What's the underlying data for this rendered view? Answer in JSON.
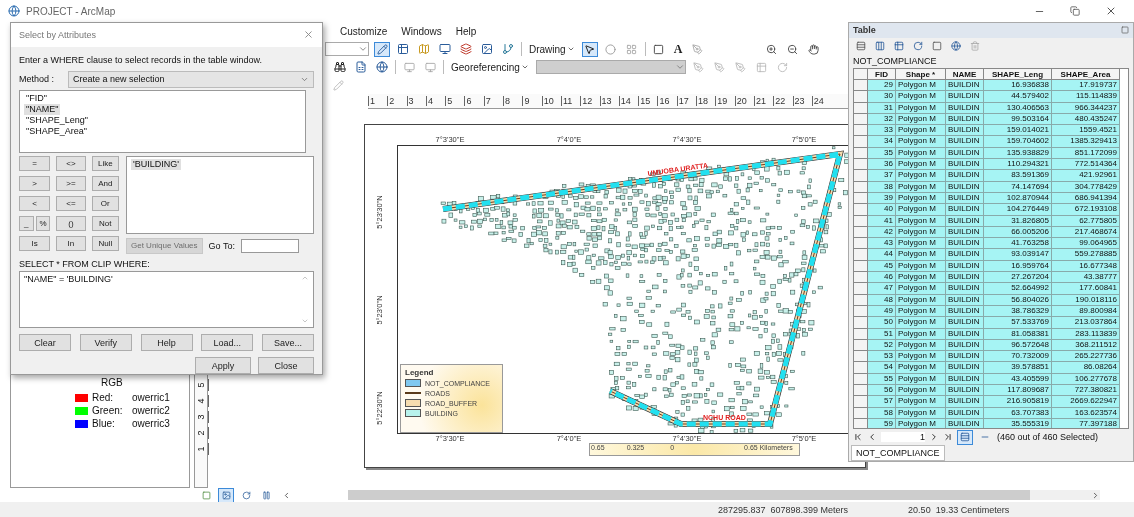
{
  "window": {
    "title": "PROJECT - ArcMap"
  },
  "menu": [
    "Customize",
    "Windows",
    "Help"
  ],
  "toolbars": {
    "drawing": "Drawing",
    "text_tool": "A",
    "georeferencing": "Georeferencing"
  },
  "ruler": {
    "horizontal": [
      "1",
      "2",
      "3",
      "4",
      "5",
      "6",
      "7",
      "8",
      "9",
      "10",
      "11",
      "12",
      "13",
      "14",
      "15",
      "16",
      "17",
      "18",
      "19",
      "20",
      "21",
      "22",
      "23",
      "24"
    ],
    "vertical": [
      "1",
      "2",
      "3",
      "4",
      "5"
    ]
  },
  "toc": {
    "band_title": "RGB",
    "bands": [
      {
        "label": "Red:",
        "value": "owerric1",
        "color": "#ff0000"
      },
      {
        "label": "Green:",
        "value": "owerric2",
        "color": "#00ff00"
      },
      {
        "label": "Blue:",
        "value": "owerric3",
        "color": "#0000ff"
      }
    ]
  },
  "map": {
    "top_labels": [
      "7°3'30\"E",
      "7°4'0\"E",
      "7°4'30\"E",
      "7°5'0\"E"
    ],
    "bottom_labels": [
      "7°3'30\"E",
      "7°4'0\"E",
      "7°4'30\"E",
      "7°5'0\"E"
    ],
    "left_labels": [
      "5°23'30\"N",
      "5°23'0\"N",
      "5°22'30\"N"
    ],
    "road_labels": [
      "UMUOBA URATTA",
      "NCHU ROAD"
    ],
    "legend": {
      "title": "Legend",
      "items": [
        {
          "label": "NOT_COMPLIANCE",
          "kind": "fill",
          "color": "#80c8f0"
        },
        {
          "label": "ROADS",
          "kind": "line",
          "color": "#5a3a1a"
        },
        {
          "label": "ROAD_BUFFER",
          "kind": "fill",
          "color": "#f5dcb0"
        },
        {
          "label": "BUILDING",
          "kind": "fill",
          "color": "#b8f2ec"
        }
      ]
    },
    "scale_bar": [
      "0.65",
      "0.325",
      "0",
      "0.65 Kilometers"
    ]
  },
  "status_bar": {
    "coordinates": "287295.837  607898.399 Meters",
    "page_position": "20.50  19.33 Centimeters"
  },
  "dialog": {
    "title": "Select by Attributes",
    "instruction": "Enter a WHERE clause to select records in the table window.",
    "method_label": "Method :",
    "method": "Create a new selection",
    "fields": [
      {
        "label": "\"FID\"",
        "selected": false
      },
      {
        "label": "\"NAME\"",
        "selected": true
      },
      {
        "label": "\"SHAPE_Leng\"",
        "selected": false
      },
      {
        "label": "\"SHAPE_Area\"",
        "selected": false
      }
    ],
    "operators": [
      [
        [
          "="
        ],
        [
          "<>"
        ],
        [
          "Like"
        ]
      ],
      [
        [
          ">"
        ],
        [
          ">="
        ],
        [
          "And"
        ]
      ],
      [
        [
          "<"
        ],
        [
          "<="
        ],
        [
          "Or"
        ]
      ],
      [
        [
          "_",
          "%"
        ],
        [
          "()"
        ],
        [
          "Not"
        ]
      ],
      [
        [
          "Is"
        ],
        [
          "In"
        ],
        [
          "Null"
        ]
      ]
    ],
    "values": [
      {
        "label": "'BUILDING'",
        "selected": true
      }
    ],
    "unique_values_button": {
      "label": "Get Unique Values",
      "disabled": true
    },
    "goto_label": "Go To:",
    "query_label": "SELECT * FROM CLIP WHERE:",
    "expression": "\"NAME\" = 'BUILDING'",
    "buttons": [
      "Clear",
      "Verify",
      "Help",
      "Load...",
      "Save..."
    ],
    "footer_buttons": [
      "Apply",
      "Close"
    ]
  },
  "table": {
    "title": "Table",
    "layer": "NOT_COMPLIANCE",
    "columns": [
      "FID",
      "Shape *",
      "NAME",
      "SHAPE_Leng",
      "SHAPE_Area"
    ],
    "rows": [
      {
        "cells": [
          "29",
          "Polygon M",
          "BUILDIN",
          "16.936838",
          "17.919737"
        ],
        "selected": true
      },
      {
        "cells": [
          "30",
          "Polygon M",
          "BUILDIN",
          "44.579402",
          "115.114839"
        ],
        "selected": true
      },
      {
        "cells": [
          "31",
          "Polygon M",
          "BUILDIN",
          "130.406563",
          "966.344237"
        ],
        "selected": true
      },
      {
        "cells": [
          "32",
          "Polygon M",
          "BUILDIN",
          "99.503164",
          "480.435247"
        ],
        "selected": true
      },
      {
        "cells": [
          "33",
          "Polygon M",
          "BUILDIN",
          "159.014021",
          "1559.4521"
        ],
        "selected": true
      },
      {
        "cells": [
          "34",
          "Polygon M",
          "BUILDIN",
          "159.704602",
          "1385.329413"
        ],
        "selected": true
      },
      {
        "cells": [
          "35",
          "Polygon M",
          "BUILDIN",
          "135.938829",
          "851.172099"
        ],
        "selected": true
      },
      {
        "cells": [
          "36",
          "Polygon M",
          "BUILDIN",
          "110.294321",
          "772.514364"
        ],
        "selected": true
      },
      {
        "cells": [
          "37",
          "Polygon M",
          "BUILDIN",
          "83.591369",
          "421.92961"
        ],
        "selected": true
      },
      {
        "cells": [
          "38",
          "Polygon M",
          "BUILDIN",
          "74.147694",
          "304.778429"
        ],
        "selected": true
      },
      {
        "cells": [
          "39",
          "Polygon M",
          "BUILDIN",
          "102.870944",
          "686.941394"
        ],
        "selected": true
      },
      {
        "cells": [
          "40",
          "Polygon M",
          "BUILDIN",
          "104.276449",
          "672.193108"
        ],
        "selected": true
      },
      {
        "cells": [
          "41",
          "Polygon M",
          "BUILDIN",
          "31.826805",
          "62.775805"
        ],
        "selected": true
      },
      {
        "cells": [
          "42",
          "Polygon M",
          "BUILDIN",
          "66.005206",
          "217.468674"
        ],
        "selected": true
      },
      {
        "cells": [
          "43",
          "Polygon M",
          "BUILDIN",
          "41.763258",
          "99.064965"
        ],
        "selected": true
      },
      {
        "cells": [
          "44",
          "Polygon M",
          "BUILDIN",
          "93.039147",
          "559.278885"
        ],
        "selected": true
      },
      {
        "cells": [
          "45",
          "Polygon M",
          "BUILDIN",
          "16.959764",
          "16.677348"
        ],
        "selected": true
      },
      {
        "cells": [
          "46",
          "Polygon M",
          "BUILDIN",
          "27.267204",
          "43.38777"
        ],
        "selected": true
      },
      {
        "cells": [
          "47",
          "Polygon M",
          "BUILDIN",
          "52.664992",
          "177.60841"
        ],
        "selected": true
      },
      {
        "cells": [
          "48",
          "Polygon M",
          "BUILDIN",
          "56.804026",
          "190.018116"
        ],
        "selected": true
      },
      {
        "cells": [
          "49",
          "Polygon M",
          "BUILDIN",
          "38.786329",
          "89.800984"
        ],
        "selected": true
      },
      {
        "cells": [
          "50",
          "Polygon M",
          "BUILDIN",
          "57.533769",
          "213.037864"
        ],
        "selected": true
      },
      {
        "cells": [
          "51",
          "Polygon M",
          "BUILDIN",
          "81.058381",
          "283.113839"
        ],
        "selected": true
      },
      {
        "cells": [
          "52",
          "Polygon M",
          "BUILDIN",
          "96.572648",
          "368.211512"
        ],
        "selected": true
      },
      {
        "cells": [
          "53",
          "Polygon M",
          "BUILDIN",
          "70.732009",
          "265.227736"
        ],
        "selected": true
      },
      {
        "cells": [
          "54",
          "Polygon M",
          "BUILDIN",
          "39.578851",
          "86.08264"
        ],
        "selected": true
      },
      {
        "cells": [
          "55",
          "Polygon M",
          "BUILDIN",
          "43.405599",
          "106.277678"
        ],
        "selected": true
      },
      {
        "cells": [
          "56",
          "Polygon M",
          "BUILDIN",
          "117.809687",
          "727.380821"
        ],
        "selected": true
      },
      {
        "cells": [
          "57",
          "Polygon M",
          "BUILDIN",
          "216.905819",
          "2669.622947"
        ],
        "selected": true
      },
      {
        "cells": [
          "58",
          "Polygon M",
          "BUILDIN",
          "63.707383",
          "163.623574"
        ],
        "selected": true
      },
      {
        "cells": [
          "59",
          "Polygon M",
          "BUILDIN",
          "35.555319",
          "77.397188"
        ],
        "selected": true
      }
    ],
    "page": "1",
    "selection_count": "(460 out of 460 Selected)",
    "tab": "NOT_COMPLIANCE"
  }
}
